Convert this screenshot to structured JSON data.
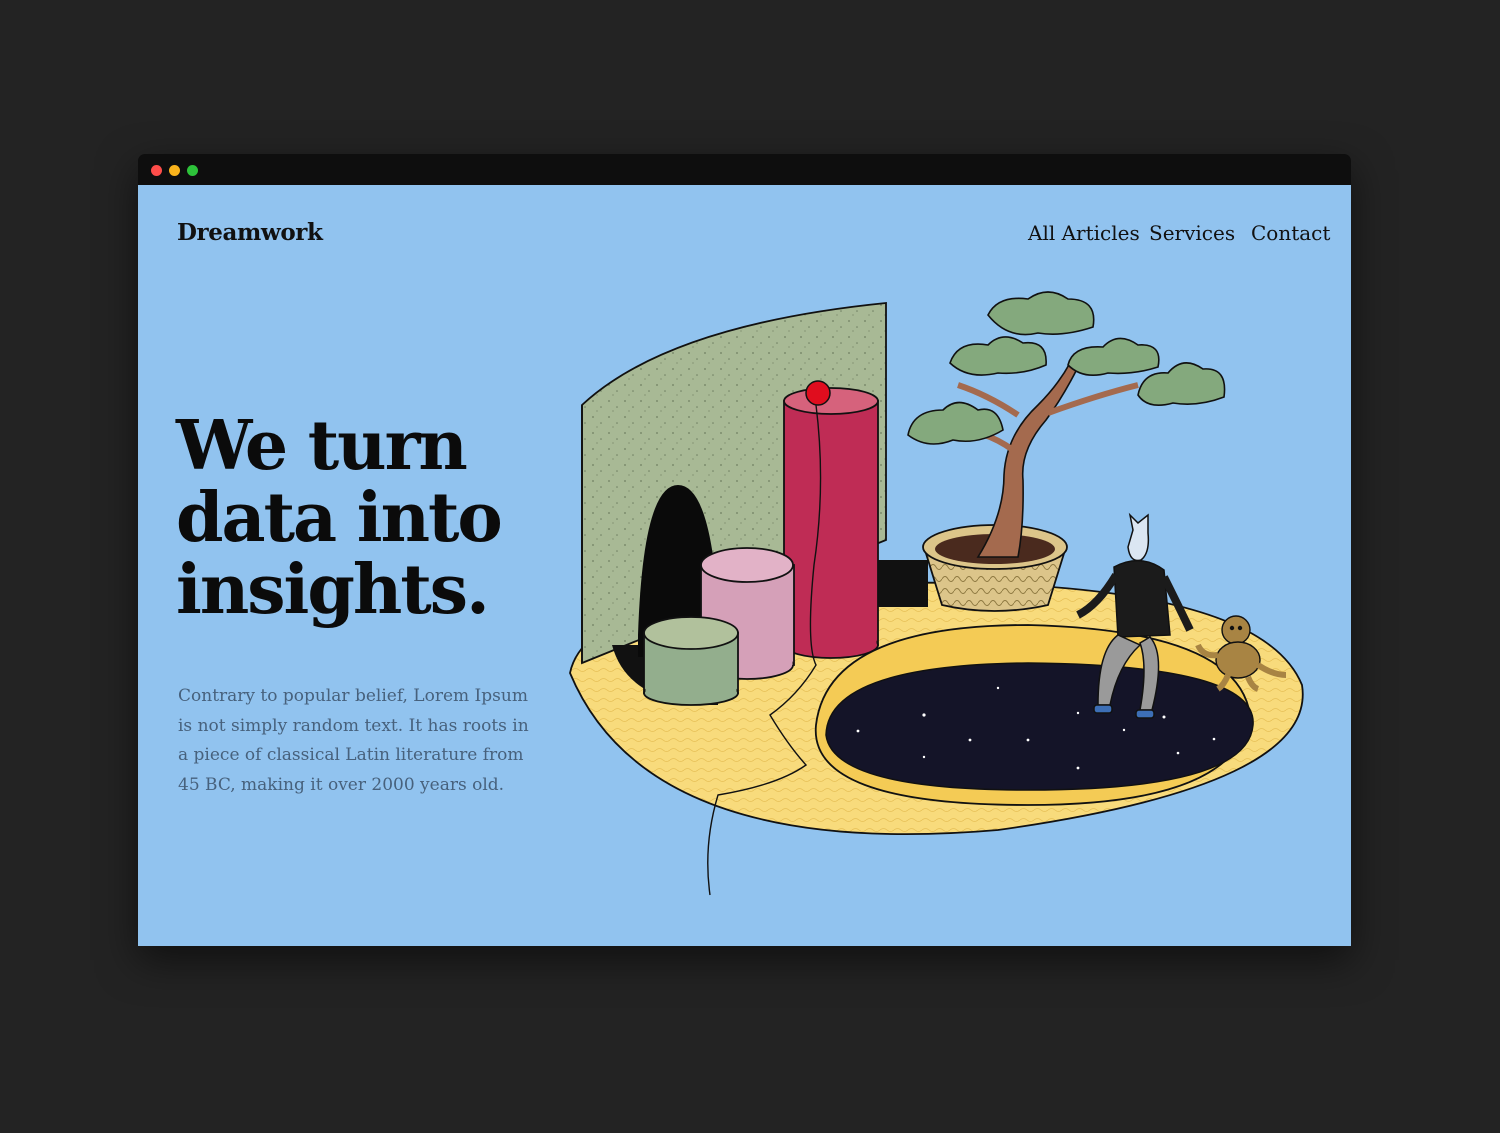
{
  "brand": {
    "logo": "Dreamwork"
  },
  "nav": {
    "items": [
      {
        "label": "All Articles"
      },
      {
        "label": "Services"
      },
      {
        "label": "Contact"
      }
    ]
  },
  "hero": {
    "headline_lines": [
      "We turn",
      "data into",
      "insights."
    ],
    "body_lines": [
      "Contrary to popular belief, Lorem Ipsum",
      "is not simply random text. It has roots in",
      "a piece of classical Latin literature from",
      "45 BC, making it over 2000 years old."
    ]
  },
  "colors": {
    "desktop_bg": "#232323",
    "page_bg": "#91c3ef",
    "platform": "#f8db7c",
    "panel": "#a8b995",
    "tall_cylinder": "#bf2c55",
    "pink_cylinder": "#d5a0b8",
    "green_cylinder": "#93ae8d",
    "ball": "#e00d1e",
    "foliage": "#84a97d",
    "trunk": "#a46a4e",
    "void": "#141428"
  }
}
